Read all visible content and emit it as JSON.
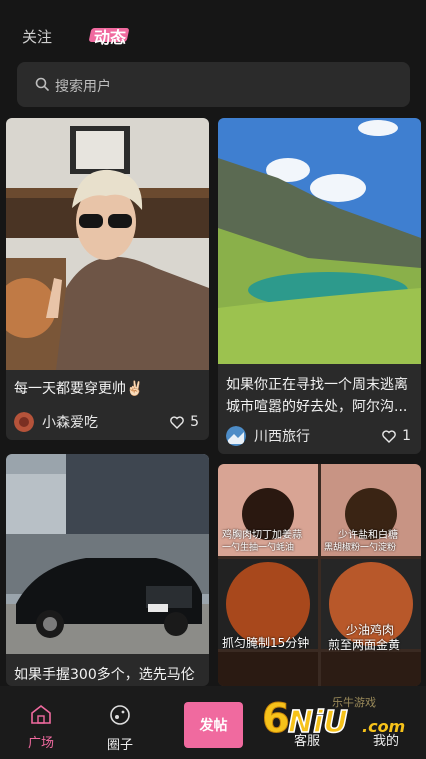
{
  "tabs": {
    "follow": "关注",
    "dynamic": "动态"
  },
  "search": {
    "placeholder": "搜索用户"
  },
  "posts": [
    {
      "title": "每一天都要穿更帅✌🏻",
      "author": "小森爱吃",
      "likes": "5"
    },
    {
      "title": "如果你正在寻找一个周末逃离城市喧嚣的好去处，阿尔沟...",
      "author": "川西旅行",
      "likes": "1"
    },
    {
      "title": "如果手握300多个，选先马伦"
    },
    {
      "food_captions": [
        "鸡胸肉切丁加姜蒜",
        "一勺生抽一勺蚝油",
        "黑胡椒粉一勺淀粉",
        "少许盐和白糖",
        "抓匀腌制15分钟",
        "少油鸡肉",
        "煎至两面金黄"
      ]
    }
  ],
  "nav": {
    "square": "广场",
    "circle": "圈子",
    "post": "发帖",
    "service": "客服",
    "mine": "我的"
  },
  "watermark": {
    "brand": "6NiU",
    "domain": ".com",
    "tag": "乐牛游戏"
  },
  "colors": {
    "accent": "#f06a9f",
    "background": "#161616",
    "card": "#2a2a2a"
  }
}
